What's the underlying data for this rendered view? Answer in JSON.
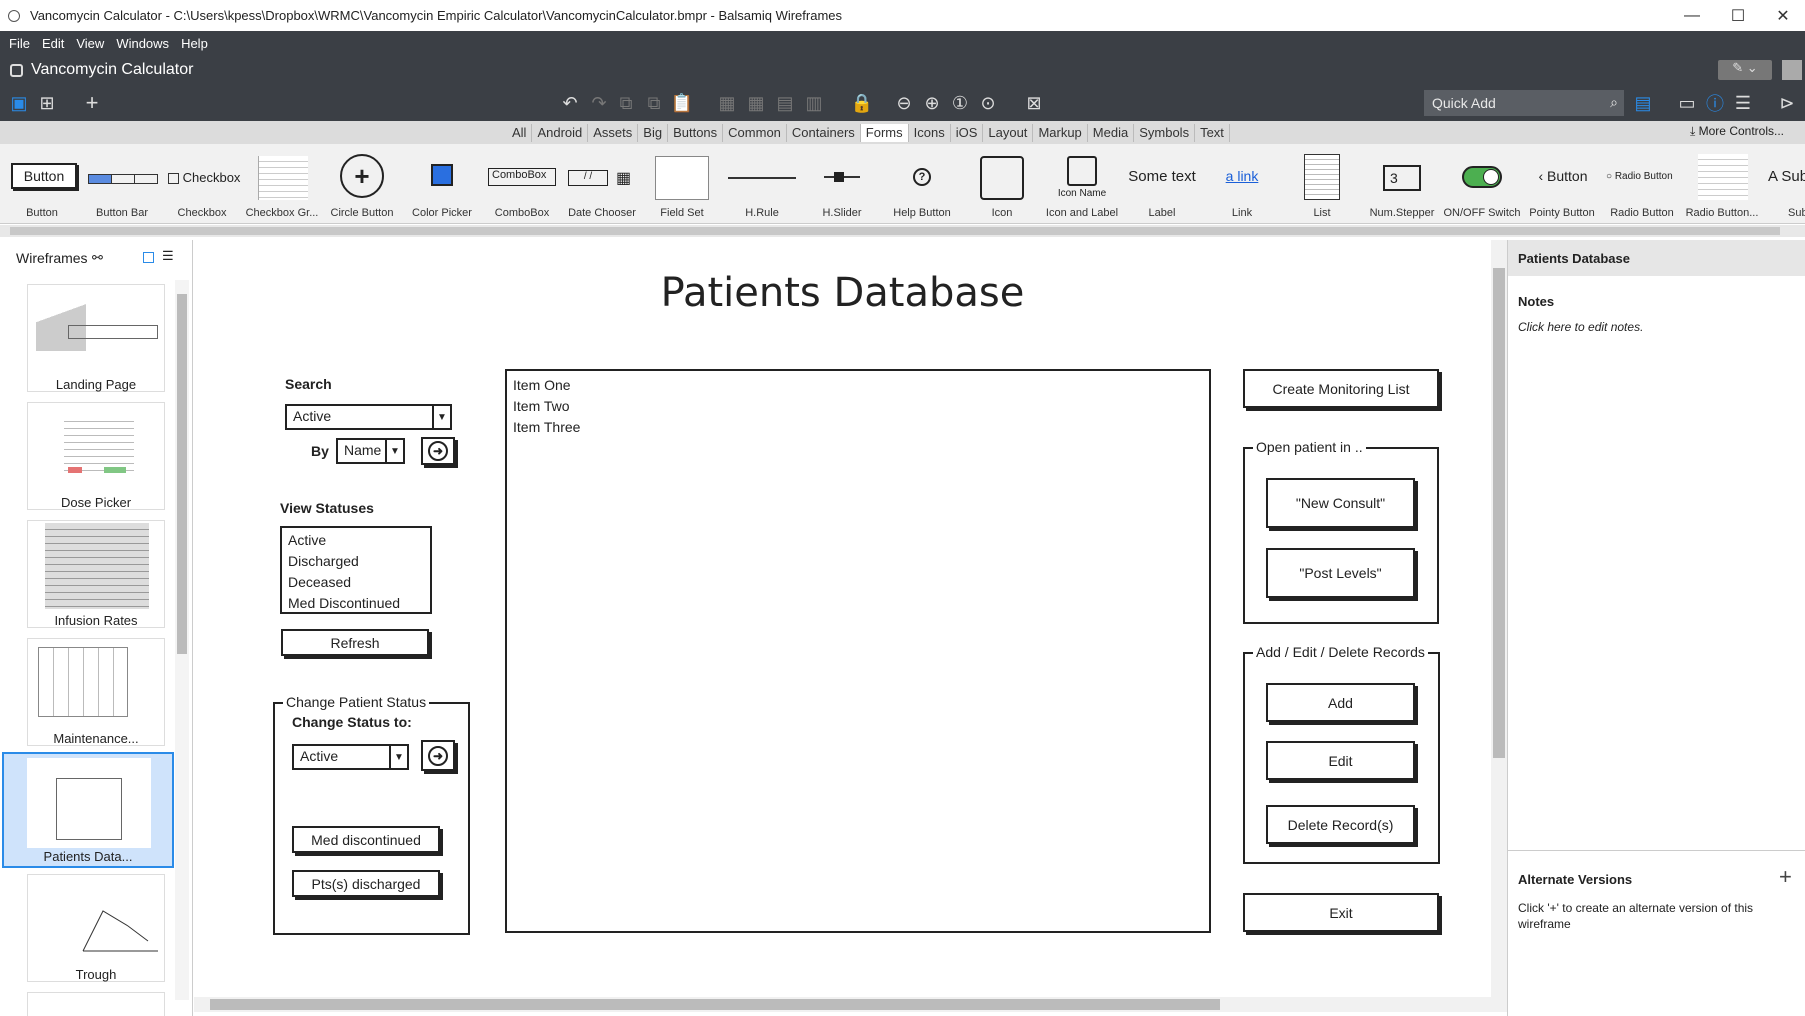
{
  "window": {
    "title": "Vancomycin Calculator - C:\\Users\\kpess\\Dropbox\\WRMC\\Vancomycin Empiric Calculator\\VancomycinCalculator.bmpr - Balsamiq Wireframes",
    "minimize": "—",
    "maximize": "☐",
    "close": "✕"
  },
  "menu": [
    "File",
    "Edit",
    "View",
    "Windows",
    "Help"
  ],
  "app": {
    "title": "Vancomycin Calculator"
  },
  "toolbar": {
    "quick_add": "Quick Add"
  },
  "categories": [
    "All",
    "Android",
    "Assets",
    "Big",
    "Buttons",
    "Common",
    "Containers",
    "Forms",
    "Icons",
    "iOS",
    "Layout",
    "Markup",
    "Media",
    "Symbols",
    "Text"
  ],
  "active_category": "Forms",
  "more_controls": "More Controls...",
  "library": [
    {
      "label": "Button",
      "preview": "Button"
    },
    {
      "label": "Button Bar",
      "preview": ""
    },
    {
      "label": "Checkbox",
      "preview": "Checkbox"
    },
    {
      "label": "Checkbox Gr...",
      "preview": ""
    },
    {
      "label": "Circle Button",
      "preview": ""
    },
    {
      "label": "Color Picker",
      "preview": ""
    },
    {
      "label": "ComboBox",
      "preview": "ComboBox"
    },
    {
      "label": "Date Chooser",
      "preview": ""
    },
    {
      "label": "Field Set",
      "preview": ""
    },
    {
      "label": "H.Rule",
      "preview": ""
    },
    {
      "label": "H.Slider",
      "preview": ""
    },
    {
      "label": "Help Button",
      "preview": ""
    },
    {
      "label": "Icon",
      "preview": ""
    },
    {
      "label": "Icon and Label",
      "preview": "Icon Name"
    },
    {
      "label": "Label",
      "preview": "Some text"
    },
    {
      "label": "Link",
      "preview": "a link"
    },
    {
      "label": "List",
      "preview": ""
    },
    {
      "label": "Num.Stepper",
      "preview": "3"
    },
    {
      "label": "ON/OFF Switch",
      "preview": ""
    },
    {
      "label": "Pointy Button",
      "preview": "Button"
    },
    {
      "label": "Radio Button",
      "preview": "Radio Button"
    },
    {
      "label": "Radio Button...",
      "preview": ""
    },
    {
      "label": "Subt",
      "preview": "A Sub"
    }
  ],
  "left_panel": {
    "title": "Wireframes",
    "pages": [
      "Landing Page",
      "Dose Picker",
      "Infusion Rates",
      "Maintenance...",
      "Patients Data...",
      "Trough"
    ]
  },
  "wireframe": {
    "title": "Patients Database",
    "search_label": "Search",
    "search_value": "Active",
    "by_label": "By",
    "by_value": "Name",
    "view_statuses_label": "View Statuses",
    "statuses": [
      "Active",
      "Discharged",
      "Deceased",
      "Med Discontinued"
    ],
    "refresh": "Refresh",
    "change_status_legend": "Change Patient Status",
    "change_status_to": "Change Status to:",
    "change_status_value": "Active",
    "med_discontinued": "Med discontinued",
    "pts_discharged": "Pts(s) discharged",
    "list_items": [
      "Item One",
      "Item Two",
      "Item Three"
    ],
    "create_monitoring_list": "Create Monitoring List",
    "open_patient_legend": "Open patient in ..",
    "new_consult": "\"New Consult\"",
    "post_levels": "\"Post Levels\"",
    "records_legend": "Add / Edit / Delete Records",
    "add": "Add",
    "edit": "Edit",
    "delete": "Delete Record(s)",
    "exit": "Exit"
  },
  "right_panel": {
    "title": "Patients Database",
    "notes_label": "Notes",
    "notes_placeholder": "Click here to edit notes.",
    "alt_versions_label": "Alternate Versions",
    "alt_versions_text": "Click '+' to create an alternate version of this wireframe"
  },
  "colors": {
    "chrome": "#3b3f45",
    "accent": "#1e88e5",
    "selected_thumb": "#cfe3fb"
  }
}
